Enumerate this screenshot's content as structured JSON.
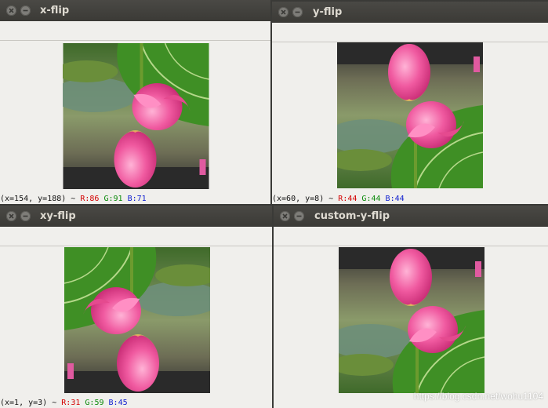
{
  "windows": [
    {
      "title": "x-flip",
      "status": {
        "coords": "(x=154, y=188) ~ ",
        "r": "R:86",
        "g": "G:91",
        "b": "B:71"
      }
    },
    {
      "title": "y-flip",
      "status": {
        "coords": "(x=60, y=8) ~ ",
        "r": "R:44",
        "g": "G:44",
        "b": "B:44"
      }
    },
    {
      "title": "xy-flip",
      "status": {
        "coords": "(x=1, y=3) ~ ",
        "r": "R:31",
        "g": "G:59",
        "b": "B:45"
      }
    },
    {
      "title": "custom-y-flip",
      "status": {
        "coords": "",
        "r": "",
        "g": "",
        "b": ""
      }
    }
  ],
  "watermark": "https://blog.csdn.net/wohu1104",
  "icons": {
    "close": "close-icon",
    "minimize": "minimize-icon"
  },
  "colors": {
    "titlebar": "#3c3b37",
    "window_bg": "#f0efec",
    "r": "#d40000",
    "g": "#0a8a0a",
    "b": "#1020d0"
  }
}
